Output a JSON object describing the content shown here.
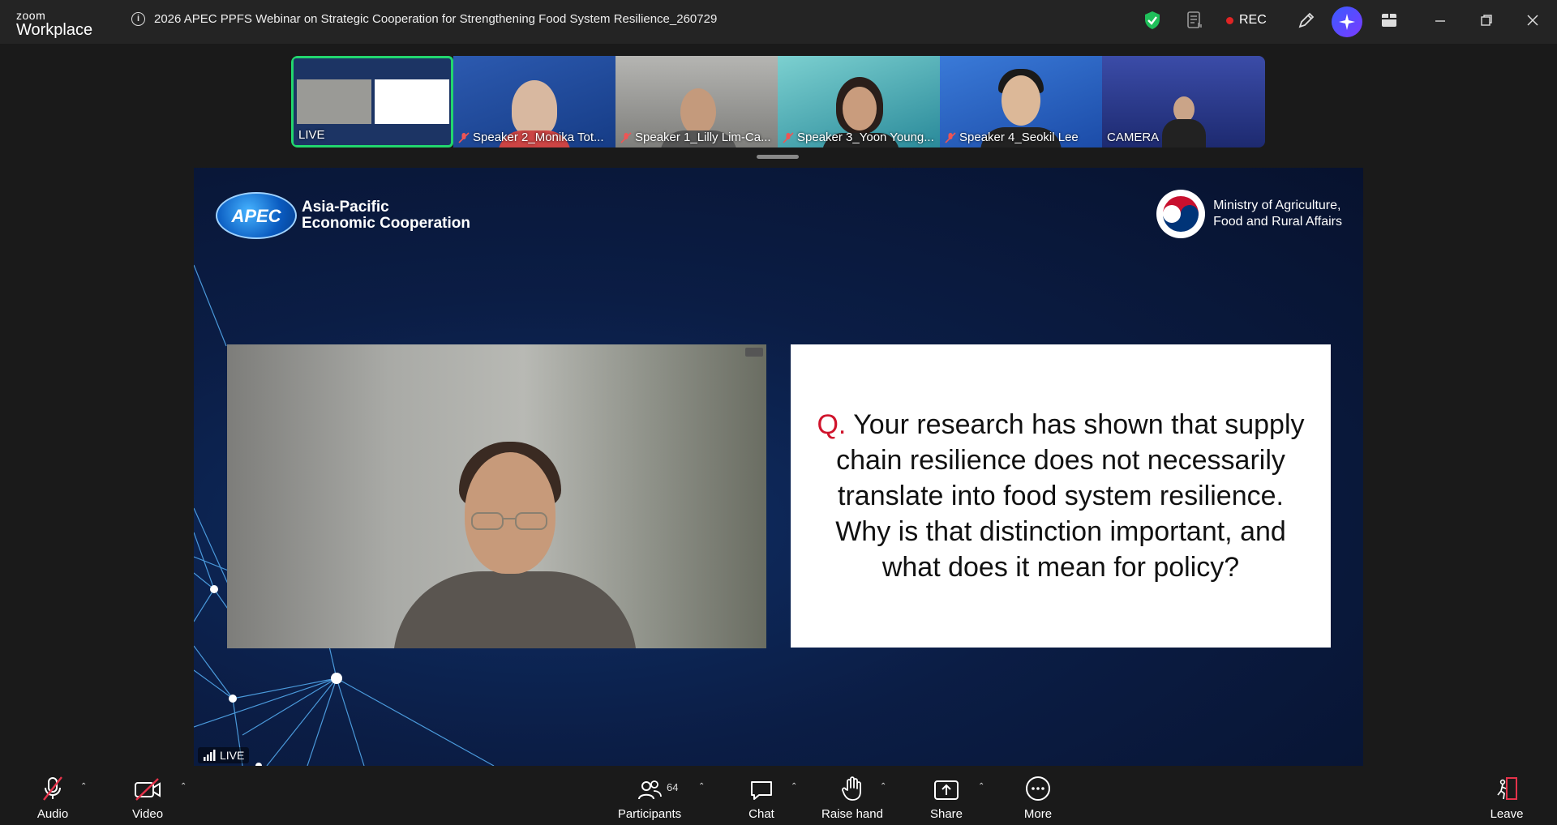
{
  "window": {
    "logo_small": "zoom",
    "logo_big": "Workplace",
    "info_icon": "info-icon",
    "title": "2026 APEC PPFS Webinar on Strategic Cooperation for Strengthening Food System Resilience_260729",
    "rec_label": "REC",
    "rec_color": "#e02424"
  },
  "gallery": {
    "tiles": [
      {
        "label": "LIVE",
        "muted": false,
        "active": true
      },
      {
        "label": "Speaker 2_Monika Tot...",
        "muted": true
      },
      {
        "label": "Speaker 1_Lilly Lim-Ca...",
        "muted": true
      },
      {
        "label": "Speaker 3_Yoon Young...",
        "muted": true
      },
      {
        "label": "Speaker 4_Seokil Lee",
        "muted": true
      },
      {
        "label": "CAMERA",
        "muted": false
      }
    ],
    "active_color": "#22d66e"
  },
  "stage": {
    "apec_globe_text": "APEC",
    "apec_line1": "Asia-Pacific",
    "apec_line2": "Economic Cooperation",
    "ministry_line1": "Ministry of Agriculture,",
    "ministry_line2": "Food and Rural Affairs",
    "question_prefix": "Q.",
    "question_body": "Your research has shown that supply chain resilience does not necessarily translate into food system resilience. Why is that distinction important, and what does it mean for policy?",
    "live_label": "LIVE"
  },
  "toolbar": {
    "audio": "Audio",
    "video": "Video",
    "participants": "Participants",
    "participants_count": "64",
    "chat": "Chat",
    "raise_hand": "Raise hand",
    "share": "Share",
    "more": "More",
    "leave": "Leave"
  }
}
